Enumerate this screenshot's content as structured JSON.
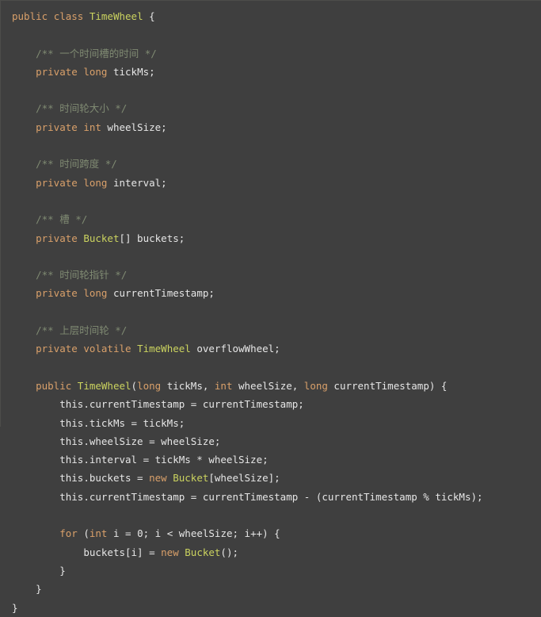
{
  "editor": {
    "name": "java-code-snippet",
    "language": "Java",
    "background_color": "#3f3f3f",
    "foreground_color": "#e6e6e6",
    "colors": {
      "keyword": "#d9a06a",
      "type": "#cbd35f",
      "comment": "#7f8a72",
      "number": "#7d93c4",
      "plain": "#e6e6e6"
    }
  },
  "code": {
    "lines": [
      {
        "indent": 0,
        "tokens": [
          {
            "t": "public",
            "c": "kw"
          },
          {
            "t": " ",
            "c": "plain"
          },
          {
            "t": "class",
            "c": "kw"
          },
          {
            "t": " ",
            "c": "plain"
          },
          {
            "t": "TimeWheel",
            "c": "type"
          },
          {
            "t": " {",
            "c": "plain"
          }
        ]
      },
      {
        "indent": 0,
        "tokens": []
      },
      {
        "indent": 1,
        "tokens": [
          {
            "t": "/** 一个时间槽的时间 */",
            "c": "comment"
          }
        ]
      },
      {
        "indent": 1,
        "tokens": [
          {
            "t": "private",
            "c": "kw"
          },
          {
            "t": " ",
            "c": "plain"
          },
          {
            "t": "long",
            "c": "kw"
          },
          {
            "t": " tickMs;",
            "c": "plain"
          }
        ]
      },
      {
        "indent": 0,
        "tokens": []
      },
      {
        "indent": 1,
        "tokens": [
          {
            "t": "/** 时间轮大小 */",
            "c": "comment"
          }
        ]
      },
      {
        "indent": 1,
        "tokens": [
          {
            "t": "private",
            "c": "kw"
          },
          {
            "t": " ",
            "c": "plain"
          },
          {
            "t": "int",
            "c": "kw"
          },
          {
            "t": " wheelSize;",
            "c": "plain"
          }
        ]
      },
      {
        "indent": 0,
        "tokens": []
      },
      {
        "indent": 1,
        "tokens": [
          {
            "t": "/** 时间跨度 */",
            "c": "comment"
          }
        ]
      },
      {
        "indent": 1,
        "tokens": [
          {
            "t": "private",
            "c": "kw"
          },
          {
            "t": " ",
            "c": "plain"
          },
          {
            "t": "long",
            "c": "kw"
          },
          {
            "t": " interval;",
            "c": "plain"
          }
        ]
      },
      {
        "indent": 0,
        "tokens": []
      },
      {
        "indent": 1,
        "tokens": [
          {
            "t": "/** 槽 */",
            "c": "comment"
          }
        ]
      },
      {
        "indent": 1,
        "tokens": [
          {
            "t": "private",
            "c": "kw"
          },
          {
            "t": " ",
            "c": "plain"
          },
          {
            "t": "Bucket",
            "c": "type"
          },
          {
            "t": "[] buckets;",
            "c": "plain"
          }
        ]
      },
      {
        "indent": 0,
        "tokens": []
      },
      {
        "indent": 1,
        "tokens": [
          {
            "t": "/** 时间轮指针 */",
            "c": "comment"
          }
        ]
      },
      {
        "indent": 1,
        "tokens": [
          {
            "t": "private",
            "c": "kw"
          },
          {
            "t": " ",
            "c": "plain"
          },
          {
            "t": "long",
            "c": "kw"
          },
          {
            "t": " currentTimestamp;",
            "c": "plain"
          }
        ]
      },
      {
        "indent": 0,
        "tokens": []
      },
      {
        "indent": 1,
        "tokens": [
          {
            "t": "/** 上层时间轮 */",
            "c": "comment"
          }
        ]
      },
      {
        "indent": 1,
        "tokens": [
          {
            "t": "private",
            "c": "kw"
          },
          {
            "t": " ",
            "c": "plain"
          },
          {
            "t": "volatile",
            "c": "kw"
          },
          {
            "t": " ",
            "c": "plain"
          },
          {
            "t": "TimeWheel",
            "c": "type"
          },
          {
            "t": " overflowWheel;",
            "c": "plain"
          }
        ]
      },
      {
        "indent": 0,
        "tokens": []
      },
      {
        "indent": 1,
        "tokens": [
          {
            "t": "public",
            "c": "kw"
          },
          {
            "t": " ",
            "c": "plain"
          },
          {
            "t": "TimeWheel",
            "c": "type"
          },
          {
            "t": "(",
            "c": "plain"
          },
          {
            "t": "long",
            "c": "kw"
          },
          {
            "t": " tickMs, ",
            "c": "plain"
          },
          {
            "t": "int",
            "c": "kw"
          },
          {
            "t": " wheelSize, ",
            "c": "plain"
          },
          {
            "t": "long",
            "c": "kw"
          },
          {
            "t": " currentTimestamp) {",
            "c": "plain"
          }
        ]
      },
      {
        "indent": 2,
        "tokens": [
          {
            "t": "this.currentTimestamp = currentTimestamp;",
            "c": "plain"
          }
        ]
      },
      {
        "indent": 2,
        "tokens": [
          {
            "t": "this.tickMs = tickMs;",
            "c": "plain"
          }
        ]
      },
      {
        "indent": 2,
        "tokens": [
          {
            "t": "this.wheelSize = wheelSize;",
            "c": "plain"
          }
        ]
      },
      {
        "indent": 2,
        "tokens": [
          {
            "t": "this.interval = tickMs * wheelSize;",
            "c": "plain"
          }
        ]
      },
      {
        "indent": 2,
        "tokens": [
          {
            "t": "this.buckets = ",
            "c": "plain"
          },
          {
            "t": "new",
            "c": "kw"
          },
          {
            "t": " ",
            "c": "plain"
          },
          {
            "t": "Bucket",
            "c": "type"
          },
          {
            "t": "[wheelSize];",
            "c": "plain"
          }
        ]
      },
      {
        "indent": 2,
        "tokens": [
          {
            "t": "this.currentTimestamp = currentTimestamp - (currentTimestamp % tickMs);",
            "c": "plain"
          }
        ]
      },
      {
        "indent": 0,
        "tokens": []
      },
      {
        "indent": 2,
        "tokens": [
          {
            "t": "for",
            "c": "kw"
          },
          {
            "t": " (",
            "c": "plain"
          },
          {
            "t": "int",
            "c": "kw"
          },
          {
            "t": " i = ",
            "c": "plain"
          },
          {
            "t": "0",
            "c": "num"
          },
          {
            "t": "; i < wheelSize; i++) {",
            "c": "plain"
          }
        ]
      },
      {
        "indent": 3,
        "tokens": [
          {
            "t": "buckets[i] = ",
            "c": "plain"
          },
          {
            "t": "new",
            "c": "kw"
          },
          {
            "t": " ",
            "c": "plain"
          },
          {
            "t": "Bucket",
            "c": "type"
          },
          {
            "t": "();",
            "c": "plain"
          }
        ]
      },
      {
        "indent": 2,
        "tokens": [
          {
            "t": "}",
            "c": "plain"
          }
        ]
      },
      {
        "indent": 1,
        "tokens": [
          {
            "t": "}",
            "c": "plain"
          }
        ]
      },
      {
        "indent": 0,
        "tokens": [
          {
            "t": "}",
            "c": "plain"
          }
        ]
      }
    ]
  }
}
